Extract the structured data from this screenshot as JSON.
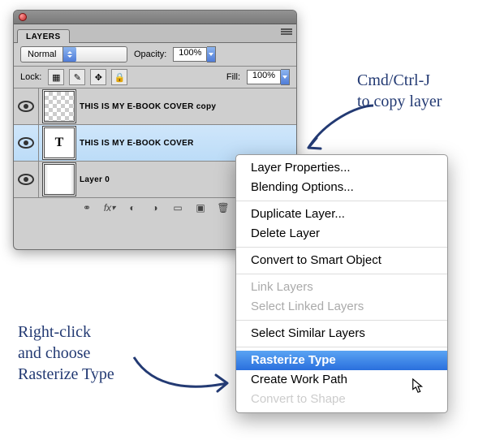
{
  "panel": {
    "tab": "LAYERS",
    "blend_mode": "Normal",
    "opacity_label": "Opacity:",
    "opacity_value": "100%",
    "lock_label": "Lock:",
    "fill_label": "Fill:",
    "fill_value": "100%",
    "layers": [
      {
        "name": "THIS IS  MY  E-BOOK COVER copy",
        "selected": false,
        "kind": "checker"
      },
      {
        "name": "THIS IS  MY  E-BOOK COVER",
        "selected": true,
        "kind": "type"
      },
      {
        "name": "Layer 0",
        "selected": false,
        "kind": "page"
      }
    ],
    "footer_icons": [
      "link-icon",
      "fx-icon",
      "mask-icon",
      "adjust-icon",
      "group-icon",
      "new-icon",
      "trash-icon"
    ]
  },
  "context_menu": {
    "groups": [
      [
        {
          "label": "Layer Properties...",
          "enabled": true,
          "highlight": false
        },
        {
          "label": "Blending Options...",
          "enabled": true,
          "highlight": false
        }
      ],
      [
        {
          "label": "Duplicate Layer...",
          "enabled": true,
          "highlight": false
        },
        {
          "label": "Delete Layer",
          "enabled": true,
          "highlight": false
        }
      ],
      [
        {
          "label": "Convert to Smart Object",
          "enabled": true,
          "highlight": false
        }
      ],
      [
        {
          "label": "Link Layers",
          "enabled": false,
          "highlight": false
        },
        {
          "label": "Select Linked Layers",
          "enabled": false,
          "highlight": false
        }
      ],
      [
        {
          "label": "Select Similar Layers",
          "enabled": true,
          "highlight": false
        }
      ],
      [
        {
          "label": "Rasterize Type",
          "enabled": true,
          "highlight": true
        },
        {
          "label": "Create Work Path",
          "enabled": true,
          "highlight": false
        },
        {
          "label": "Convert to Shape",
          "enabled": true,
          "highlight": false,
          "faded": true
        }
      ]
    ]
  },
  "annotations": {
    "copy_layer": "Cmd/Ctrl-J\nto copy layer",
    "rasterize": "Right-click\nand choose\nRasterize Type"
  },
  "colors": {
    "highlight": "#3d82e6",
    "ink": "#233a73"
  }
}
